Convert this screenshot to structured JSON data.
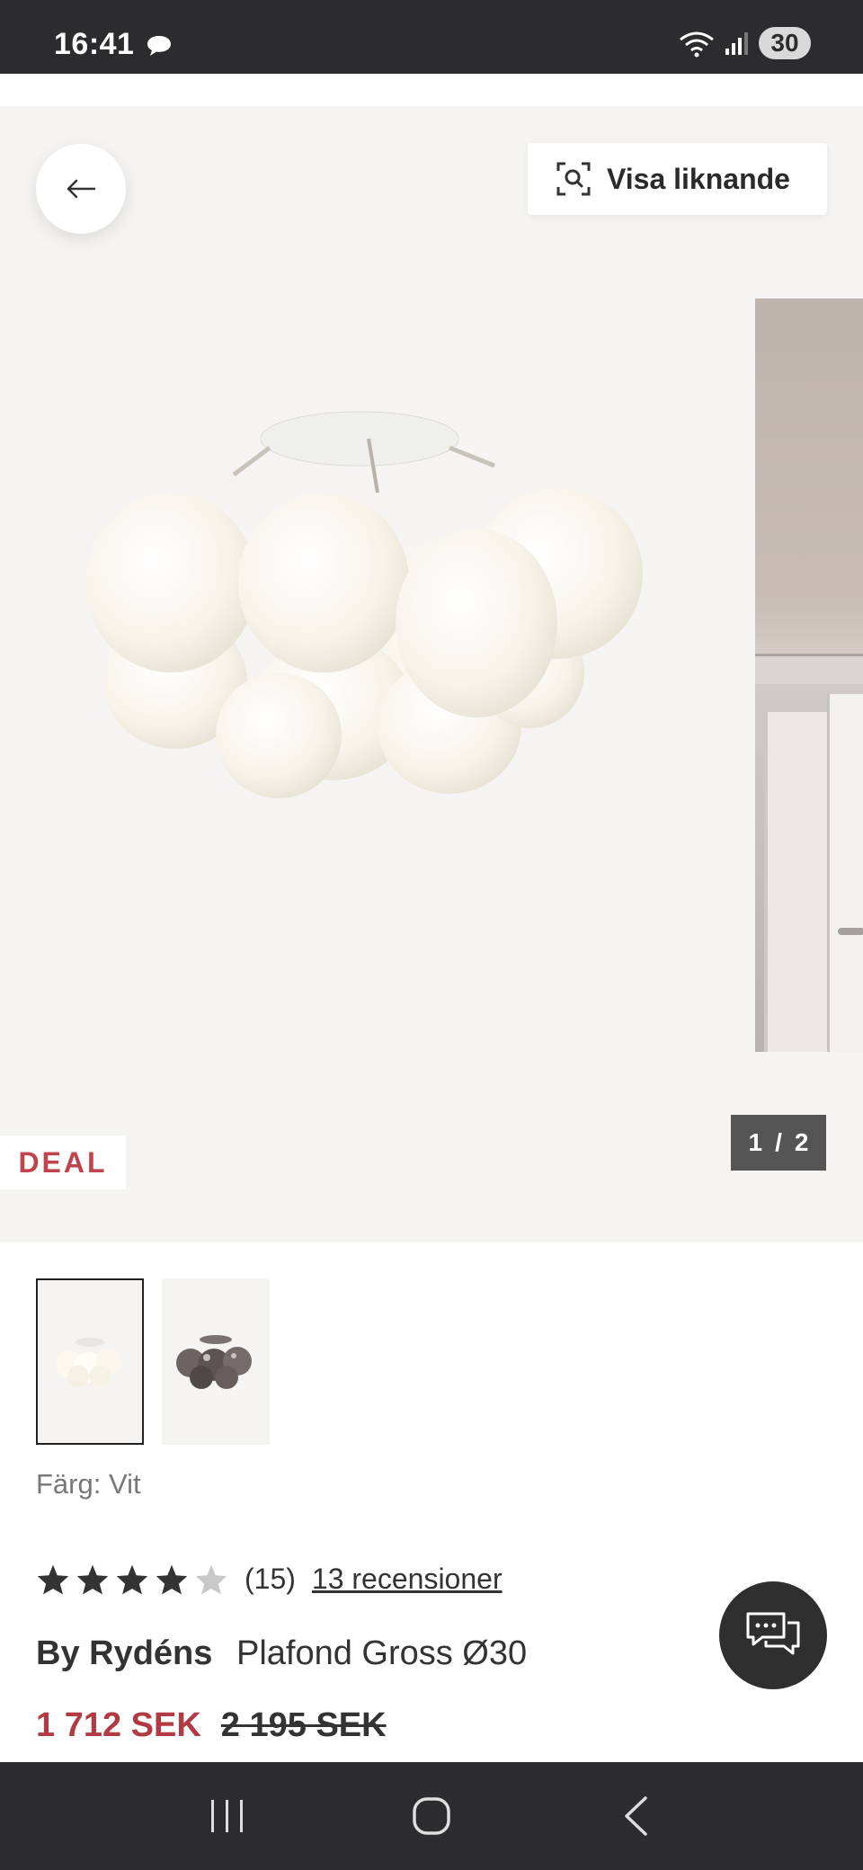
{
  "status_bar": {
    "time": "16:41",
    "battery": "30"
  },
  "gallery": {
    "similar_button_label": "Visa liknande",
    "deal_badge": "DEAL",
    "counter": {
      "current": "1",
      "separator": "/",
      "total": "2"
    }
  },
  "product": {
    "color_label": "Färg: Vit",
    "rating": {
      "stars": 4,
      "max": 5,
      "count": "(15)",
      "reviews_link": "13 recensioner"
    },
    "brand": "By Rydéns",
    "name": "Plafond Gross Ø30",
    "price": "1 712 SEK",
    "old_price": "2 195 SEK"
  },
  "colors": {
    "accent_price": "#b23a44",
    "deal": "#c0444e",
    "dark_bar": "#2c2c2e"
  },
  "icons": {
    "back": "arrow-left-icon",
    "similar": "visual-search-icon",
    "chat": "chat-bubbles-icon",
    "nav_recent": "recent-apps-icon",
    "nav_home": "home-icon",
    "nav_back": "back-chevron-icon"
  }
}
